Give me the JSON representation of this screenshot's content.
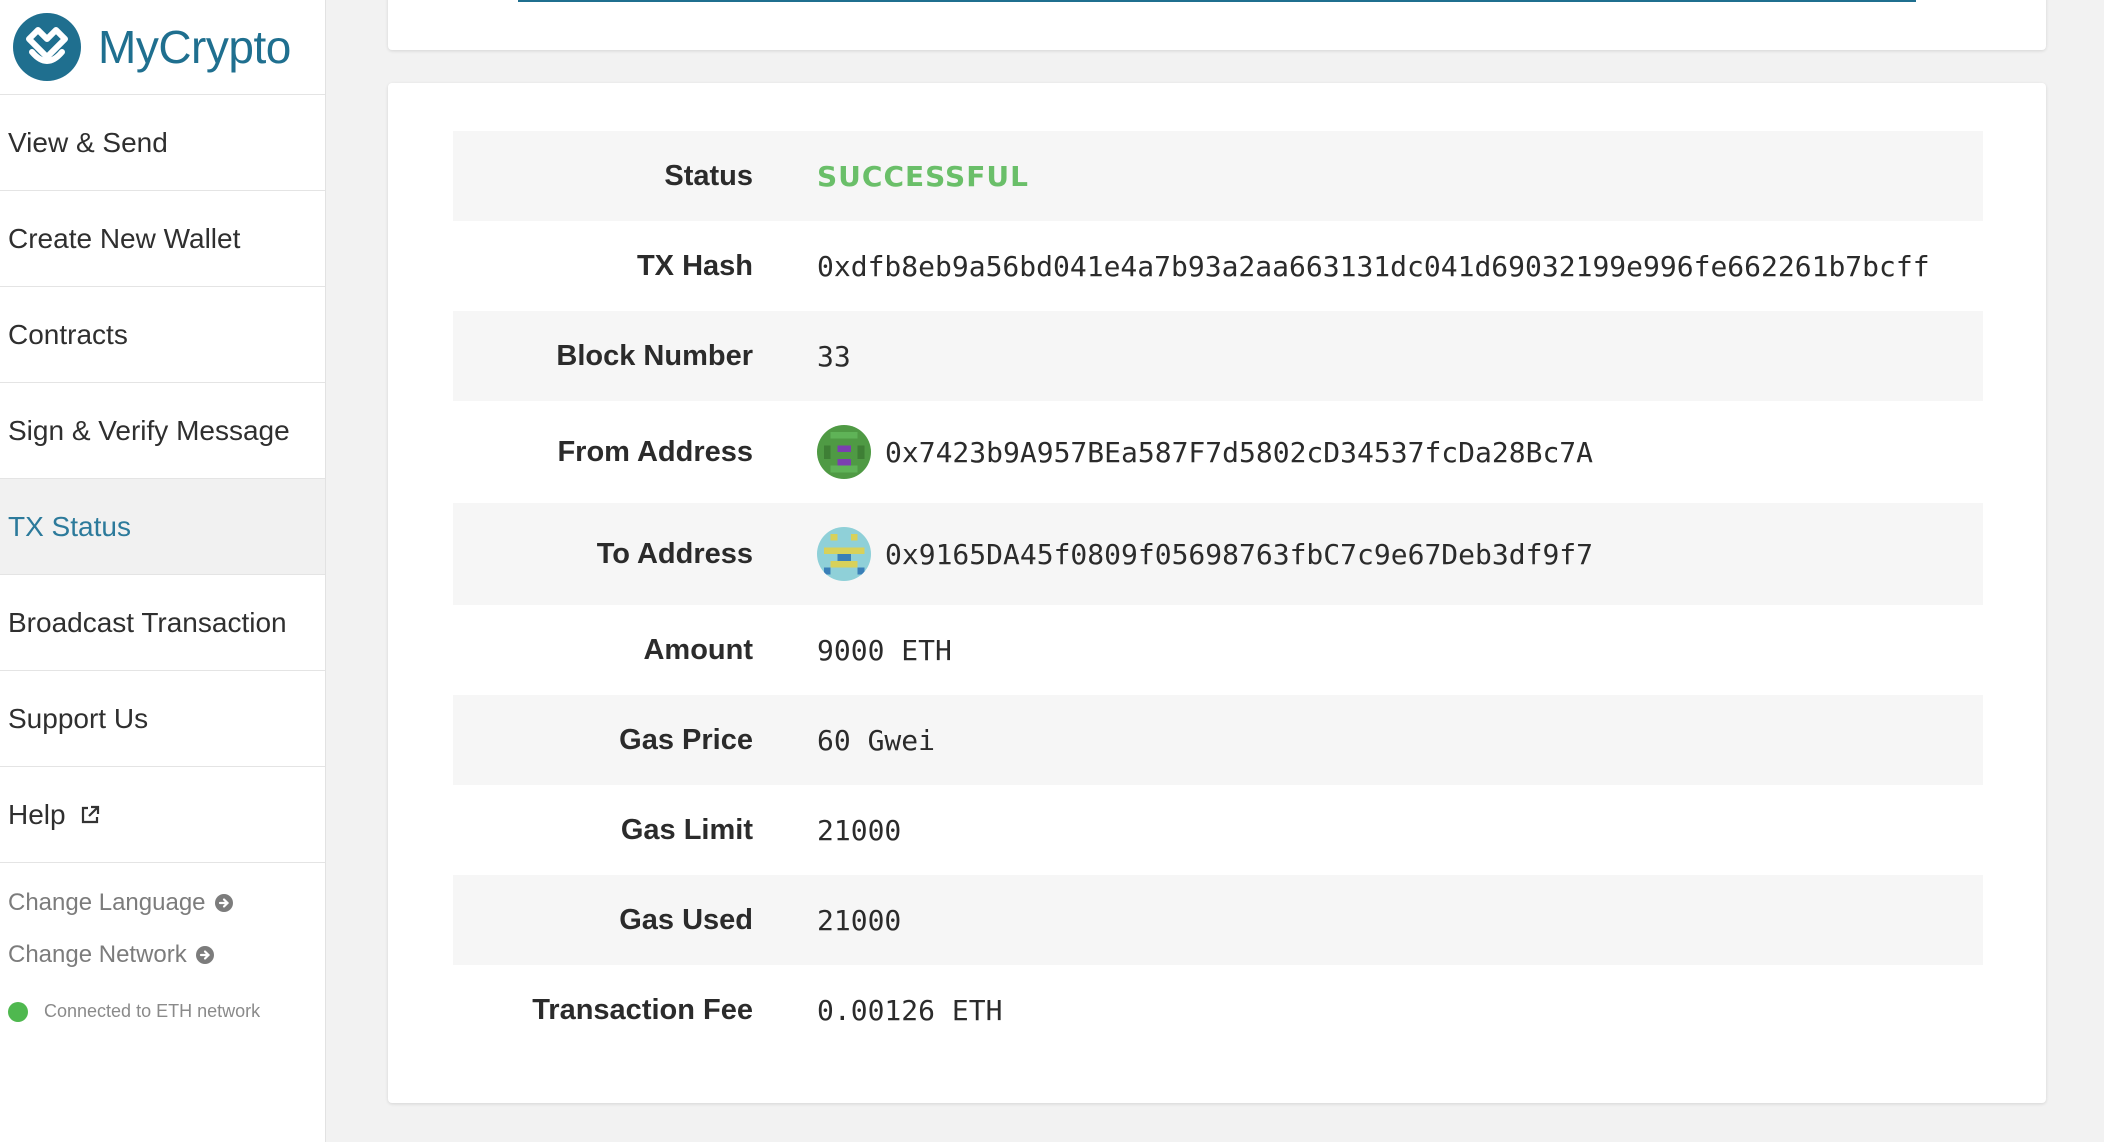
{
  "brand": {
    "name": "MyCrypto"
  },
  "sidebar": {
    "items": [
      {
        "label": "View & Send",
        "active": false
      },
      {
        "label": "Create New Wallet",
        "active": false
      },
      {
        "label": "Contracts",
        "active": false
      },
      {
        "label": "Sign & Verify Message",
        "active": false
      },
      {
        "label": "TX Status",
        "active": true
      },
      {
        "label": "Broadcast Transaction",
        "active": false
      },
      {
        "label": "Support Us",
        "active": false
      },
      {
        "label": "Help",
        "active": false,
        "icon": "external-link-icon"
      }
    ],
    "change_language": "Change Language",
    "change_network": "Change Network",
    "network_status": "Connected to ETH network",
    "status_color": "#4fb84f"
  },
  "tx": {
    "status": {
      "label": "Status",
      "value": "SUCCESSFUL"
    },
    "hash": {
      "label": "TX Hash",
      "value": "0xdfb8eb9a56bd041e4a7b93a2aa663131dc041d69032199e996fe662261b7bcff"
    },
    "block": {
      "label": "Block Number",
      "value": "33"
    },
    "from": {
      "label": "From Address",
      "value": "0x7423b9A957BEa587F7d5802cD34537fcDa28Bc7A"
    },
    "to": {
      "label": "To Address",
      "value": "0x9165DA45f0809f05698763fbC7c9e67Deb3df9f7"
    },
    "amount": {
      "label": "Amount",
      "value": "9000 ETH"
    },
    "gas_price": {
      "label": "Gas Price",
      "value": "60 Gwei"
    },
    "gas_limit": {
      "label": "Gas Limit",
      "value": "21000"
    },
    "gas_used": {
      "label": "Gas Used",
      "value": "21000"
    },
    "fee": {
      "label": "Transaction Fee",
      "value": "0.00126 ETH"
    }
  },
  "colors": {
    "brand": "#1f6f8f",
    "success": "#6abf69",
    "active_nav": "#2c7a9b"
  }
}
